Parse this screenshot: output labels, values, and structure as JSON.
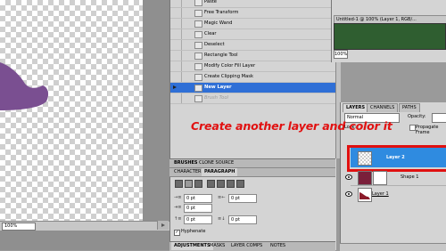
{
  "canvas": {
    "zoom": "100%"
  },
  "history": {
    "items": [
      {
        "label": "Paste",
        "state": "normal"
      },
      {
        "label": "Free Transform",
        "state": "normal"
      },
      {
        "label": "Magic Wand",
        "state": "normal"
      },
      {
        "label": "Clear",
        "state": "normal"
      },
      {
        "label": "Deselect",
        "state": "normal"
      },
      {
        "label": "Rectangle Tool",
        "state": "normal"
      },
      {
        "label": "Modify Color Fill Layer",
        "state": "normal"
      },
      {
        "label": "Create Clipping Mask",
        "state": "normal"
      },
      {
        "label": "New Layer",
        "state": "selected"
      },
      {
        "label": "Brush Tool",
        "state": "dim"
      }
    ]
  },
  "navigator": {
    "doc_tab": "Untitled-1 @ 100% (Layer 1, RGB/...",
    "zoom": "100%",
    "thumb_color": "#2f5e30"
  },
  "brushes_tabs": [
    "BRUSHES",
    "CLONE SOURCE"
  ],
  "char_tabs": [
    "CHARACTER",
    "PARAGRAPH"
  ],
  "paragraph": {
    "left_indent": "0 pt",
    "right_indent": "0 pt",
    "first_line": "0 pt",
    "space_before": "0 pt",
    "space_after": "0 pt",
    "hyphenate_label": "Hyphenate",
    "hyphenate_checked": "✓"
  },
  "adjust_tabs": [
    "ADJUSTMENTS",
    "MASKS",
    "LAYER COMPS",
    "NOTES"
  ],
  "layers": {
    "tabs": [
      "LAYERS",
      "CHANNELS",
      "PATHS"
    ],
    "blend_mode": "Normal",
    "opacity_label": "Opacity:",
    "lock_label": "Lock:",
    "propagate_label": "Propagate Frame",
    "rows": [
      {
        "name": "Layer 2"
      },
      {
        "name": "Shape 1"
      },
      {
        "name": "Layer 1"
      }
    ]
  },
  "caption": "Create another layer and color it",
  "colors": {
    "accent_red": "#e01010",
    "selection_blue": "#2f8be0",
    "shape_purple": "#7a4f91"
  }
}
